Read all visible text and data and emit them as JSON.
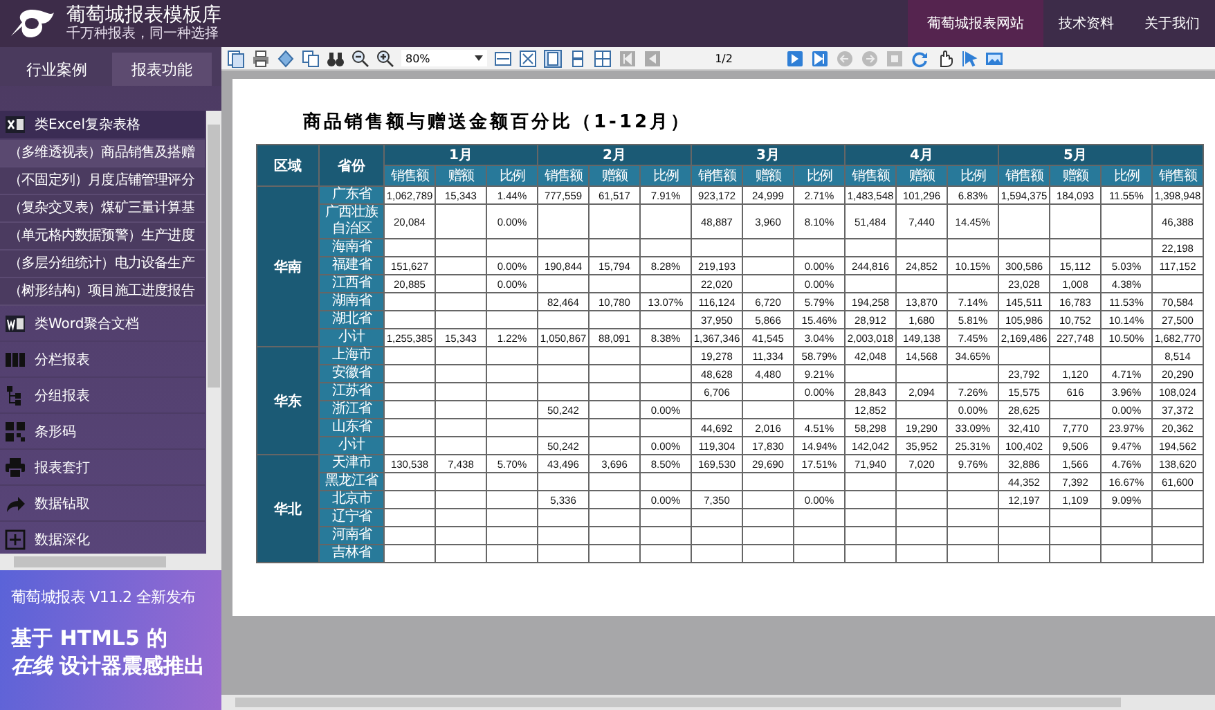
{
  "header": {
    "title": "葡萄城报表模板库",
    "subtitle": "千万种报表，同一种选择",
    "nav": [
      {
        "label": "葡萄城报表网站",
        "selected": true
      },
      {
        "label": "技术资料",
        "selected": false
      },
      {
        "label": "关于我们",
        "selected": false
      }
    ]
  },
  "sidebar": {
    "tabs": [
      {
        "label": "行业案例",
        "selected": false
      },
      {
        "label": "报表功能",
        "selected": true
      }
    ],
    "menu": [
      {
        "label": "类Excel复杂表格",
        "kind": "group",
        "expanded": true,
        "children": [
          {
            "label": "（多维透视表）商品销售及搭赠",
            "selected": true
          },
          {
            "label": "（不固定列）月度店铺管理评分",
            "selected": false
          },
          {
            "label": "（复杂交叉表）煤矿三量计算基",
            "selected": false
          },
          {
            "label": "（单元格内数据预警）生产进度",
            "selected": false
          },
          {
            "label": "（多层分组统计）电力设备生产",
            "selected": false
          },
          {
            "label": "（树形结构）项目施工进度报告",
            "selected": false
          }
        ]
      },
      {
        "label": "类Word聚合文档",
        "kind": "item"
      },
      {
        "label": "分栏报表",
        "kind": "item"
      },
      {
        "label": "分组报表",
        "kind": "item"
      },
      {
        "label": "条形码",
        "kind": "item"
      },
      {
        "label": "报表套打",
        "kind": "item"
      },
      {
        "label": "数据钻取",
        "kind": "item"
      },
      {
        "label": "数据深化",
        "kind": "item"
      }
    ],
    "banner": {
      "title": "葡萄城报表 V11.2 全新发布",
      "headline": [
        "基于 HTML5 的",
        "*在线* 设计器震感推出"
      ]
    }
  },
  "toolbar": {
    "zoom": "80%",
    "page": "1/2"
  },
  "report": {
    "title": "商品销售额与赠送金额百分比（1-12月）",
    "region_heading": "区域",
    "province_heading": "省份",
    "months": [
      {
        "label": "1月",
        "columns": [
          "销售额",
          "赠额",
          "比例"
        ]
      },
      {
        "label": "2月",
        "columns": [
          "销售额",
          "赠额",
          "比例"
        ]
      },
      {
        "label": "3月",
        "columns": [
          "销售额",
          "赠额",
          "比例"
        ]
      },
      {
        "label": "4月",
        "columns": [
          "销售额",
          "赠额",
          "比例"
        ]
      },
      {
        "label": "5月",
        "columns": [
          "销售额",
          "赠额",
          "比例"
        ]
      },
      {
        "columns": [
          "销售额"
        ]
      }
    ],
    "groups": [
      {
        "region": "华南",
        "rows": [
          {
            "province": "广东省",
            "cells": [
              "1,062,789",
              "15,343",
              "1.44%",
              "777,559",
              "61,517",
              "7.91%",
              "923,172",
              "24,999",
              "2.71%",
              "1,483,548",
              "101,296",
              "6.83%",
              "1,594,375",
              "184,093",
              "11.55%",
              "1,398,948"
            ]
          },
          {
            "province": "广西壮族自治区",
            "cells": [
              "20,084",
              null,
              "0.00%",
              null,
              null,
              null,
              "48,887",
              "3,960",
              "8.10%",
              "51,484",
              "7,440",
              "14.45%",
              null,
              null,
              null,
              "46,388"
            ]
          },
          {
            "province": "海南省",
            "cells": [
              null,
              null,
              null,
              null,
              null,
              null,
              null,
              null,
              null,
              null,
              null,
              null,
              null,
              null,
              null,
              "22,198"
            ]
          },
          {
            "province": "福建省",
            "cells": [
              "151,627",
              null,
              "0.00%",
              "190,844",
              "15,794",
              "8.28%",
              "219,193",
              null,
              "0.00%",
              "244,816",
              "24,852",
              "10.15%",
              "300,586",
              "15,112",
              "5.03%",
              "117,152"
            ]
          },
          {
            "province": "江西省",
            "cells": [
              "20,885",
              null,
              "0.00%",
              null,
              null,
              null,
              "22,020",
              null,
              "0.00%",
              null,
              null,
              null,
              "23,028",
              "1,008",
              "4.38%",
              null
            ]
          },
          {
            "province": "湖南省",
            "cells": [
              null,
              null,
              null,
              "82,464",
              "10,780",
              "13.07%",
              "116,124",
              "6,720",
              "5.79%",
              "194,258",
              "13,870",
              "7.14%",
              "145,511",
              "16,783",
              "11.53%",
              "70,584"
            ]
          },
          {
            "province": "湖北省",
            "cells": [
              null,
              null,
              null,
              null,
              null,
              null,
              "37,950",
              "5,866",
              "15.46%",
              "28,912",
              "1,680",
              "5.81%",
              "105,986",
              "10,752",
              "10.14%",
              "27,500"
            ]
          },
          {
            "province": "小计",
            "cells": [
              "1,255,385",
              "15,343",
              "1.22%",
              "1,050,867",
              "88,091",
              "8.38%",
              "1,367,346",
              "41,545",
              "3.04%",
              "2,003,018",
              "149,138",
              "7.45%",
              "2,169,486",
              "227,748",
              "10.50%",
              "1,682,770"
            ]
          }
        ]
      },
      {
        "region": "华东",
        "rows": [
          {
            "province": "上海市",
            "cells": [
              null,
              null,
              null,
              null,
              null,
              null,
              "19,278",
              "11,334",
              "58.79%",
              "42,048",
              "14,568",
              "34.65%",
              null,
              null,
              null,
              "8,514"
            ]
          },
          {
            "province": "安徽省",
            "cells": [
              null,
              null,
              null,
              null,
              null,
              null,
              "48,628",
              "4,480",
              "9.21%",
              null,
              null,
              null,
              "23,792",
              "1,120",
              "4.71%",
              "20,290"
            ]
          },
          {
            "province": "江苏省",
            "cells": [
              null,
              null,
              null,
              null,
              null,
              null,
              "6,706",
              null,
              "0.00%",
              "28,843",
              "2,094",
              "7.26%",
              "15,575",
              "616",
              "3.96%",
              "108,024"
            ]
          },
          {
            "province": "浙江省",
            "cells": [
              null,
              null,
              null,
              "50,242",
              null,
              "0.00%",
              null,
              null,
              null,
              "12,852",
              null,
              "0.00%",
              "28,625",
              null,
              "0.00%",
              "37,372"
            ]
          },
          {
            "province": "山东省",
            "cells": [
              null,
              null,
              null,
              null,
              null,
              null,
              "44,692",
              "2,016",
              "4.51%",
              "58,298",
              "19,290",
              "33.09%",
              "32,410",
              "7,770",
              "23.97%",
              "20,362"
            ]
          },
          {
            "province": "小计",
            "cells": [
              null,
              null,
              null,
              "50,242",
              null,
              "0.00%",
              "119,304",
              "17,830",
              "14.94%",
              "142,042",
              "35,952",
              "25.31%",
              "100,402",
              "9,506",
              "9.47%",
              "194,562"
            ]
          }
        ]
      },
      {
        "region": "华北",
        "rows": [
          {
            "province": "天津市",
            "cells": [
              "130,538",
              "7,438",
              "5.70%",
              "43,496",
              "3,696",
              "8.50%",
              "169,530",
              "29,690",
              "17.51%",
              "71,940",
              "7,020",
              "9.76%",
              "32,886",
              "1,566",
              "4.76%",
              "138,620"
            ]
          },
          {
            "province": "黑龙江省",
            "cells": [
              null,
              null,
              null,
              null,
              null,
              null,
              null,
              null,
              null,
              null,
              null,
              null,
              "44,352",
              "7,392",
              "16.67%",
              "61,600"
            ]
          },
          {
            "province": "北京市",
            "cells": [
              null,
              null,
              null,
              "5,336",
              null,
              "0.00%",
              "7,350",
              null,
              "0.00%",
              null,
              null,
              null,
              "12,197",
              "1,109",
              "9.09%",
              null
            ]
          },
          {
            "province": "辽宁省",
            "cells": [
              null,
              null,
              null,
              null,
              null,
              null,
              null,
              null,
              null,
              null,
              null,
              null,
              null,
              null,
              null,
              null
            ]
          },
          {
            "province": "河南省",
            "cells": [
              null,
              null,
              null,
              null,
              null,
              null,
              null,
              null,
              null,
              null,
              null,
              null,
              null,
              null,
              null,
              null
            ]
          },
          {
            "province": "吉林省",
            "cells": [
              null,
              null,
              null,
              null,
              null,
              null,
              null,
              null,
              null,
              null,
              null,
              null,
              null,
              null,
              null,
              null
            ]
          }
        ]
      }
    ]
  }
}
